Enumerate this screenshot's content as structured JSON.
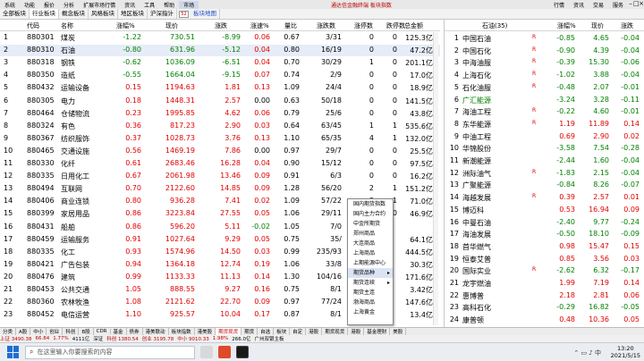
{
  "menubar": {
    "items": [
      "系统",
      "功能",
      "报价",
      "分析",
      "扩展市场行情",
      "资讯",
      "工具",
      "帮助"
    ],
    "active": "市场",
    "center_title": "通达信金融终端  板块指数",
    "right_items": [
      "行情",
      "资讯",
      "交易",
      "服务"
    ]
  },
  "tabs": {
    "items": [
      "全部板块",
      "行业板块",
      "概念板块",
      "风格板块",
      "地区板块",
      "沪深指计"
    ],
    "highlight_box": "52",
    "extra": "板块地图"
  },
  "table": {
    "columns": [
      "代码",
      "名称",
      "涨幅%",
      "现价",
      "涨跌",
      "涨速%",
      "量比",
      "涨跌数",
      "涨停数",
      "跌停数",
      "总金额"
    ],
    "rows": [
      {
        "idx": "1",
        "code": "880301",
        "name": "煤炭",
        "pct": "-1.22",
        "price": "730.51",
        "chg": "-8.99",
        "speed": "0.06",
        "vr": "0.67",
        "ud": "3/31",
        "lu": "0",
        "ld": "0",
        "amt": "125.3亿",
        "pc": "green",
        "sc": "red"
      },
      {
        "idx": "2",
        "code": "880310",
        "name": "石油",
        "pct": "-0.80",
        "price": "631.96",
        "chg": "-5.12",
        "speed": "0.04",
        "vr": "0.80",
        "ud": "16/19",
        "lu": "0",
        "ld": "0",
        "amt": "47.2亿",
        "pc": "green",
        "sc": "red"
      },
      {
        "idx": "3",
        "code": "880318",
        "name": "钢铁",
        "pct": "-0.62",
        "price": "1036.09",
        "chg": "-6.51",
        "speed": "0.04",
        "vr": "0.70",
        "ud": "30/29",
        "lu": "1",
        "ld": "0",
        "amt": "201.1亿",
        "pc": "green",
        "sc": "red"
      },
      {
        "idx": "4",
        "code": "880350",
        "name": "造纸",
        "pct": "-0.55",
        "price": "1664.04",
        "chg": "-9.15",
        "speed": "0.07",
        "vr": "0.74",
        "ud": "2/9",
        "lu": "0",
        "ld": "0",
        "amt": "17.0亿",
        "pc": "green",
        "sc": "red"
      },
      {
        "idx": "5",
        "code": "880432",
        "name": "运输设备",
        "pct": "0.15",
        "price": "1194.63",
        "chg": "1.81",
        "speed": "0.13",
        "vr": "1.09",
        "ud": "24/4",
        "lu": "0",
        "ld": "0",
        "amt": "18.9亿",
        "pc": "red",
        "sc": "red"
      },
      {
        "idx": "6",
        "code": "880305",
        "name": "电力",
        "pct": "0.18",
        "price": "1448.31",
        "chg": "2.57",
        "speed": "0.00",
        "vr": "0.63",
        "ud": "50/18",
        "lu": "0",
        "ld": "0",
        "amt": "141.5亿",
        "pc": "red",
        "sc": "blk"
      },
      {
        "idx": "7",
        "code": "880464",
        "name": "仓储物流",
        "pct": "0.23",
        "price": "1995.85",
        "chg": "4.62",
        "speed": "0.06",
        "vr": "0.79",
        "ud": "25/6",
        "lu": "0",
        "ld": "0",
        "amt": "43.8亿",
        "pc": "red",
        "sc": "red"
      },
      {
        "idx": "8",
        "code": "880324",
        "name": "有色",
        "pct": "0.36",
        "price": "817.23",
        "chg": "2.90",
        "speed": "0.03",
        "vr": "0.64",
        "ud": "63/45",
        "lu": "1",
        "ld": "1",
        "amt": "535.6亿",
        "pc": "red",
        "sc": "red"
      },
      {
        "idx": "9",
        "code": "880367",
        "name": "纺织服饰",
        "pct": "0.37",
        "price": "1028.73",
        "chg": "3.76",
        "speed": "0.13",
        "vr": "1.10",
        "ud": "65/35",
        "lu": "4",
        "ld": "1",
        "amt": "132.0亿",
        "pc": "red",
        "sc": "red"
      },
      {
        "idx": "10",
        "code": "880465",
        "name": "交通设施",
        "pct": "0.56",
        "price": "1469.19",
        "chg": "7.86",
        "speed": "0.00",
        "vr": "0.97",
        "ud": "29/7",
        "lu": "0",
        "ld": "0",
        "amt": "25.5亿",
        "pc": "red",
        "sc": "blk"
      },
      {
        "idx": "11",
        "code": "880330",
        "name": "化纤",
        "pct": "0.61",
        "price": "2683.46",
        "chg": "16.28",
        "speed": "0.04",
        "vr": "0.90",
        "ud": "15/12",
        "lu": "0",
        "ld": "0",
        "amt": "97.5亿",
        "pc": "red",
        "sc": "red"
      },
      {
        "idx": "12",
        "code": "880335",
        "name": "日用化工",
        "pct": "0.67",
        "price": "2061.98",
        "chg": "13.46",
        "speed": "0.09",
        "vr": "0.91",
        "ud": "6/3",
        "lu": "0",
        "ld": "0",
        "amt": "16.2亿",
        "pc": "red",
        "sc": "red"
      },
      {
        "idx": "13",
        "code": "880494",
        "name": "互联网",
        "pct": "0.70",
        "price": "2122.60",
        "chg": "14.85",
        "speed": "0.09",
        "vr": "1.28",
        "ud": "56/20",
        "lu": "2",
        "ld": "1",
        "amt": "151.2亿",
        "pc": "red",
        "sc": "red"
      },
      {
        "idx": "14",
        "code": "880406",
        "name": "商业连锁",
        "pct": "0.80",
        "price": "936.28",
        "chg": "7.41",
        "speed": "0.02",
        "vr": "1.09",
        "ud": "57/22",
        "lu": "3",
        "ld": "1",
        "amt": "71.0亿",
        "pc": "red",
        "sc": "red"
      },
      {
        "idx": "15",
        "code": "880399",
        "name": "家居用品",
        "pct": "0.86",
        "price": "3223.84",
        "chg": "27.55",
        "speed": "0.05",
        "vr": "1.06",
        "ud": "29/11",
        "lu": "2",
        "ld": "0",
        "amt": "46.9亿",
        "pc": "red",
        "sc": "red"
      },
      {
        "idx": "16",
        "code": "880431",
        "name": "船舶",
        "pct": "0.86",
        "price": "596.20",
        "chg": "5.11",
        "speed": "-0.02",
        "vr": "1.05",
        "ud": "7/0",
        "lu": "",
        "ld": "",
        "amt": "",
        "pc": "red",
        "sc": "green"
      },
      {
        "idx": "17",
        "code": "880459",
        "name": "运输服务",
        "pct": "0.91",
        "price": "1027.64",
        "chg": "9.29",
        "speed": "0.05",
        "vr": "0.75",
        "ud": "35/",
        "lu": "",
        "ld": "",
        "amt": "64.1亿",
        "pc": "red",
        "sc": "red"
      },
      {
        "idx": "18",
        "code": "880335",
        "name": "化工",
        "pct": "0.93",
        "price": "1574.96",
        "chg": "14.50",
        "speed": "0.03",
        "vr": "0.99",
        "ud": "235/93",
        "lu": "",
        "ld": "",
        "amt": "444.5亿",
        "pc": "red",
        "sc": "red"
      },
      {
        "idx": "19",
        "code": "880421",
        "name": "广告包装",
        "pct": "0.94",
        "price": "1364.18",
        "chg": "12.74",
        "speed": "0.19",
        "vr": "1.06",
        "ud": "33/8",
        "lu": "",
        "ld": "",
        "amt": "30.3亿",
        "pc": "red",
        "sc": "red"
      },
      {
        "idx": "20",
        "code": "880476",
        "name": "建筑",
        "pct": "0.99",
        "price": "1133.33",
        "chg": "11.13",
        "speed": "0.14",
        "vr": "1.30",
        "ud": "104/16",
        "lu": "",
        "ld": "",
        "amt": "171.6亿",
        "pc": "red",
        "sc": "red"
      },
      {
        "idx": "21",
        "code": "880453",
        "name": "公共交通",
        "pct": "1.05",
        "price": "888.55",
        "chg": "9.27",
        "speed": "0.16",
        "vr": "0.75",
        "ud": "8/1",
        "lu": "",
        "ld": "",
        "amt": "3.42亿",
        "pc": "red",
        "sc": "red"
      },
      {
        "idx": "22",
        "code": "880360",
        "name": "农林牧渔",
        "pct": "1.08",
        "price": "2121.62",
        "chg": "22.70",
        "speed": "0.09",
        "vr": "0.97",
        "ud": "77/24",
        "lu": "",
        "ld": "",
        "amt": "147.6亿",
        "pc": "red",
        "sc": "red"
      },
      {
        "idx": "23",
        "code": "880452",
        "name": "电信运营",
        "pct": "1.10",
        "price": "925.57",
        "chg": "10.04",
        "speed": "0.17",
        "vr": "0.87",
        "ud": "8/1",
        "lu": "",
        "ld": "",
        "amt": "13.4亿",
        "pc": "red",
        "sc": "red"
      }
    ]
  },
  "right_panel": {
    "header": {
      "name": "石油(35)",
      "pct": "涨幅%",
      "price": "现价",
      "chg": "涨跌"
    },
    "rows": [
      {
        "idx": "1",
        "name": "中国石油",
        "pct": "-0.85",
        "price": "4.65",
        "chg": "-0.04",
        "pc": "green",
        "nc": "blk",
        "flag": "R"
      },
      {
        "idx": "2",
        "name": "中国石化",
        "pct": "-0.90",
        "price": "4.39",
        "chg": "-0.04",
        "pc": "green",
        "nc": "blk",
        "flag": "R"
      },
      {
        "idx": "3",
        "name": "中海油服",
        "pct": "-0.39",
        "price": "15.30",
        "chg": "-0.06",
        "pc": "green",
        "nc": "blk",
        "flag": "R"
      },
      {
        "idx": "4",
        "name": "上海石化",
        "pct": "-1.02",
        "price": "3.88",
        "chg": "-0.04",
        "pc": "green",
        "nc": "blk",
        "flag": "R"
      },
      {
        "idx": "5",
        "name": "石化油服",
        "pct": "-0.48",
        "price": "2.07",
        "chg": "-0.01",
        "pc": "green",
        "nc": "blk",
        "flag": "R"
      },
      {
        "idx": "6",
        "name": "广汇能源",
        "pct": "-3.24",
        "price": "3.28",
        "chg": "-0.11",
        "pc": "green",
        "nc": "green",
        "flag": ""
      },
      {
        "idx": "7",
        "name": "海油工程",
        "pct": "-0.22",
        "price": "4.60",
        "chg": "-0.01",
        "pc": "green",
        "nc": "blk",
        "flag": "R"
      },
      {
        "idx": "8",
        "name": "东华能源",
        "pct": "1.19",
        "price": "11.89",
        "chg": "0.14",
        "pc": "red",
        "nc": "blk",
        "flag": "R"
      },
      {
        "idx": "9",
        "name": "中油工程",
        "pct": "0.69",
        "price": "2.90",
        "chg": "0.02",
        "pc": "red",
        "nc": "blk",
        "flag": ""
      },
      {
        "idx": "10",
        "name": "华锦股份",
        "pct": "-3.58",
        "price": "7.54",
        "chg": "-0.28",
        "pc": "green",
        "nc": "blk",
        "flag": ""
      },
      {
        "idx": "11",
        "name": "新潮能源",
        "pct": "-2.44",
        "price": "1.60",
        "chg": "-0.04",
        "pc": "green",
        "nc": "blk",
        "flag": ""
      },
      {
        "idx": "12",
        "name": "洲际油气",
        "pct": "-1.83",
        "price": "2.15",
        "chg": "-0.04",
        "pc": "green",
        "nc": "blk",
        "flag": "R"
      },
      {
        "idx": "13",
        "name": "广聚能源",
        "pct": "-0.84",
        "price": "8.26",
        "chg": "-0.07",
        "pc": "green",
        "nc": "blk",
        "flag": ""
      },
      {
        "idx": "14",
        "name": "海越发展",
        "pct": "0.39",
        "price": "2.57",
        "chg": "0.01",
        "pc": "red",
        "nc": "blk",
        "flag": "R"
      },
      {
        "idx": "15",
        "name": "博迈科",
        "pct": "0.53",
        "price": "16.94",
        "chg": "0.09",
        "pc": "red",
        "nc": "blk",
        "flag": ""
      },
      {
        "idx": "16",
        "name": "中曼石油",
        "pct": "-2.40",
        "price": "9.77",
        "chg": "-0.24",
        "pc": "green",
        "nc": "blk",
        "flag": ""
      },
      {
        "idx": "17",
        "name": "海油发展",
        "pct": "-0.50",
        "price": "18.10",
        "chg": "-0.09",
        "pc": "green",
        "nc": "blk",
        "flag": ""
      },
      {
        "idx": "18",
        "name": "首华燃气",
        "pct": "0.98",
        "price": "15.47",
        "chg": "0.15",
        "pc": "red",
        "nc": "blk",
        "flag": ""
      },
      {
        "idx": "19",
        "name": "恒泰艾普",
        "pct": "0.85",
        "price": "3.56",
        "chg": "0.03",
        "pc": "red",
        "nc": "blk",
        "flag": ""
      },
      {
        "idx": "20",
        "name": "国际实业",
        "pct": "-2.62",
        "price": "6.32",
        "chg": "-0.17",
        "pc": "green",
        "nc": "blk",
        "flag": "R"
      },
      {
        "idx": "21",
        "name": "龙宇燃油",
        "pct": "1.99",
        "price": "7.19",
        "chg": "0.14",
        "pc": "red",
        "nc": "blk",
        "flag": ""
      },
      {
        "idx": "22",
        "name": "惠博普",
        "pct": "2.18",
        "price": "2.81",
        "chg": "0.06",
        "pc": "red",
        "nc": "blk",
        "flag": ""
      },
      {
        "idx": "23",
        "name": "高科石化",
        "pct": "-0.29",
        "price": "16.82",
        "chg": "-0.05",
        "pc": "green",
        "nc": "blk",
        "flag": ""
      },
      {
        "idx": "24",
        "name": "康普顿",
        "pct": "0.48",
        "price": "10.36",
        "chg": "0.05",
        "pc": "red",
        "nc": "blk",
        "flag": ""
      }
    ]
  },
  "context_menu": {
    "items": [
      {
        "label": "国内期货指数",
        "arrow": false
      },
      {
        "label": "国内主力合约",
        "arrow": false
      },
      {
        "label": "中金所期货",
        "arrow": false
      },
      {
        "label": "郑州商品",
        "arrow": false
      },
      {
        "label": "大连商品",
        "arrow": false
      },
      {
        "label": "上海商品",
        "arrow": false
      },
      {
        "label": "上期能源中心",
        "arrow": false
      },
      {
        "label": "期货品种",
        "arrow": true
      },
      {
        "label": "期货连续",
        "arrow": true
      },
      {
        "label": "期货主连",
        "arrow": false
      },
      {
        "label": "渤海商品",
        "arrow": false
      },
      {
        "label": "上海黄金",
        "arrow": false
      }
    ]
  },
  "bottom_tabs": [
    "分类",
    "A股",
    "中小",
    "创业",
    "科创",
    "B股",
    "CDR",
    "基金",
    "债券",
    "港美联动",
    "板块指数",
    "港美股",
    "期货现货",
    "期货",
    "自选",
    "板块",
    "自定",
    "港股",
    "期货现货",
    "港股",
    "基金理财",
    "美股"
  ],
  "bottom_active": "期货现货",
  "statusbar": {
    "items": [
      "上证 3490.38",
      "66.84",
      "1.77%",
      "4111亿",
      "深证",
      "科创 1380.54",
      "创业 3195.78",
      "中小 9010.33",
      "1.98%",
      "266.0亿",
      "广州双银主板"
    ]
  },
  "taskbar": {
    "search_placeholder": "在这里输入你要搜索的内容",
    "time": "13:20",
    "date": "2021/5/15"
  },
  "colors": {
    "up": "#e00000",
    "down": "#008000",
    "accent": "#2050d0"
  }
}
